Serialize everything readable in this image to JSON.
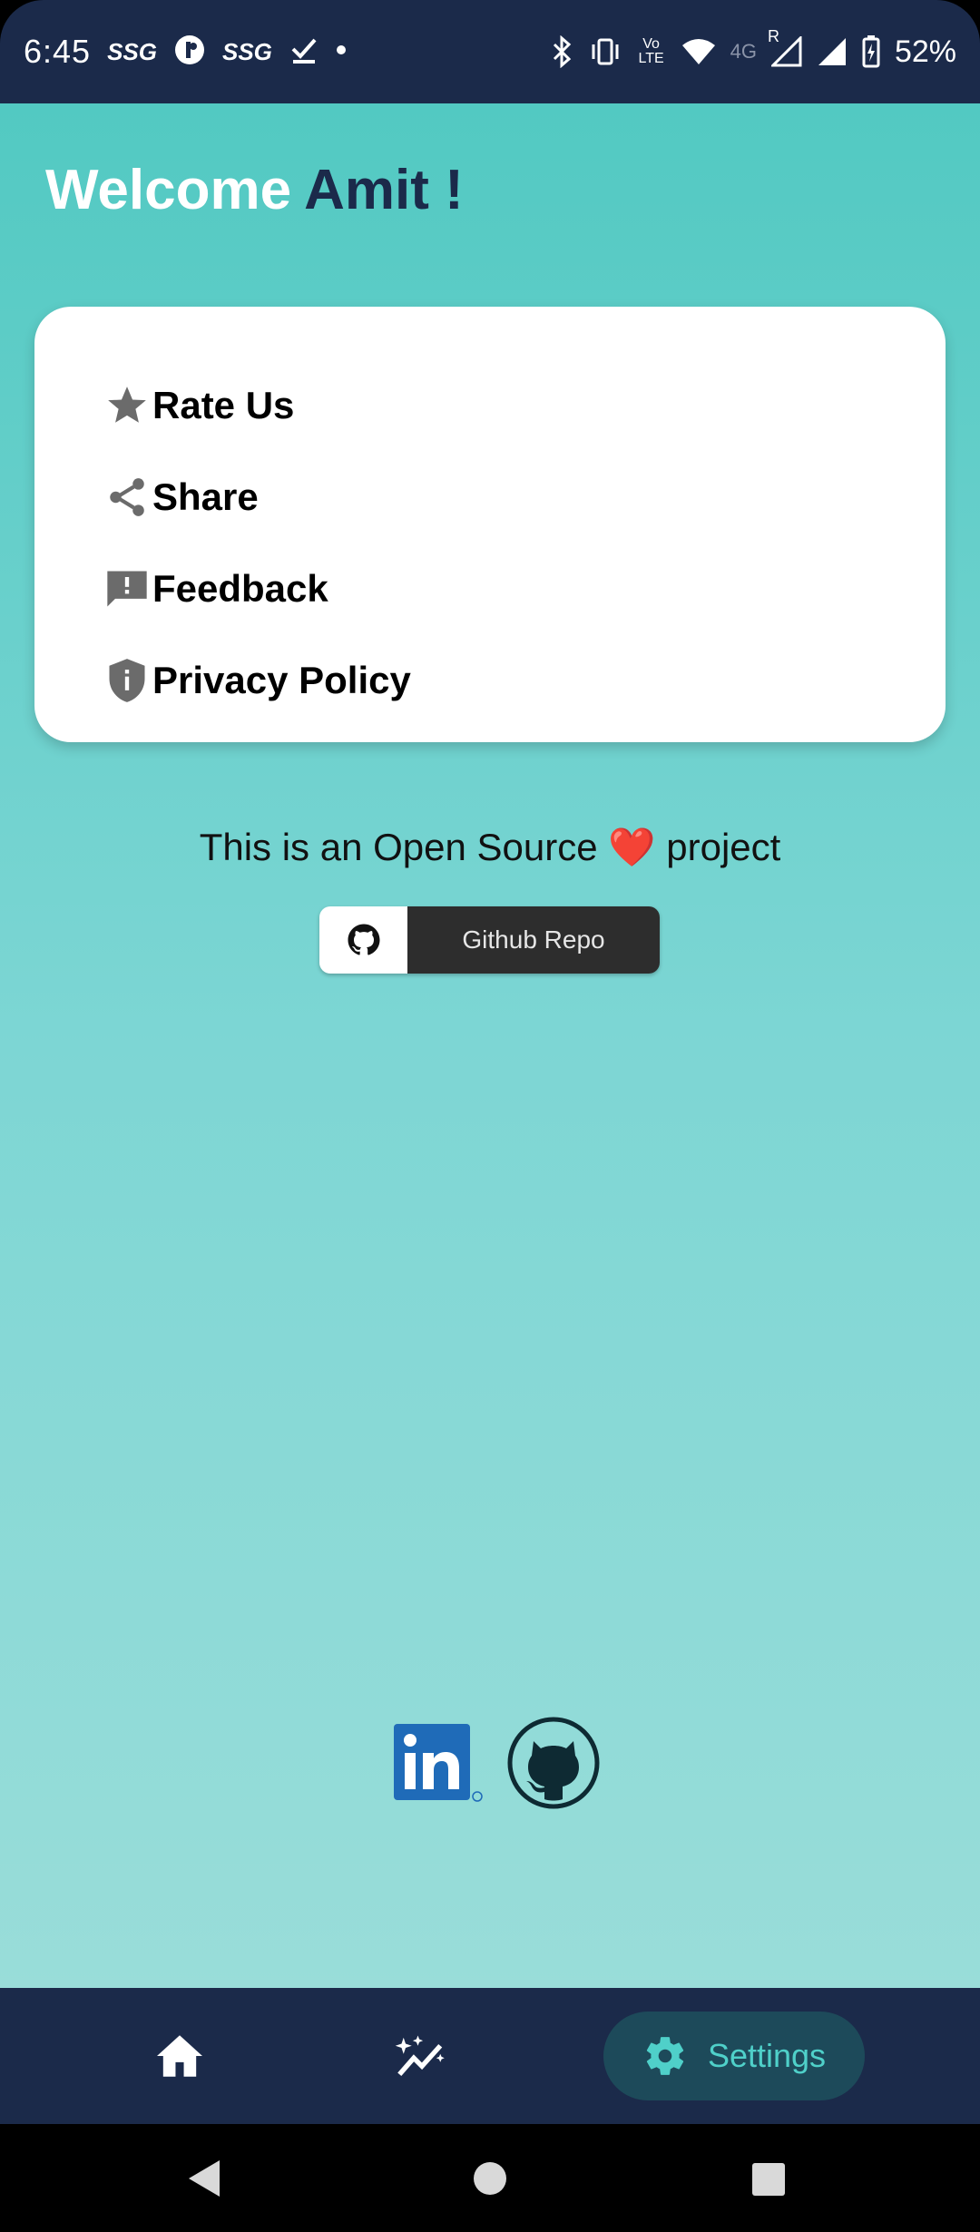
{
  "status_bar": {
    "time": "6:45",
    "left_icons": [
      "SSG",
      "SSG"
    ],
    "network_label": "4G",
    "roaming": "R",
    "volte_label": "Vo LTE",
    "battery": "52%"
  },
  "header": {
    "welcome_word": "Welcome",
    "user_name": "Amit !"
  },
  "menu": {
    "items": [
      {
        "label": "Rate Us",
        "icon": "star-icon"
      },
      {
        "label": "Share",
        "icon": "share-icon"
      },
      {
        "label": "Feedback",
        "icon": "feedback-icon"
      },
      {
        "label": "Privacy Policy",
        "icon": "shield-info-icon"
      }
    ]
  },
  "open_source": {
    "text_before": "This is an Open Source",
    "heart": "❤️",
    "text_after": "project"
  },
  "github_button": {
    "label": "Github Repo"
  },
  "bottom_nav": {
    "settings_label": "Settings"
  },
  "colors": {
    "nav_bg": "#1b2a4a",
    "accent": "#4fd0c9",
    "gradient_top": "#52c9c2",
    "gradient_bottom": "#99ddd9"
  }
}
